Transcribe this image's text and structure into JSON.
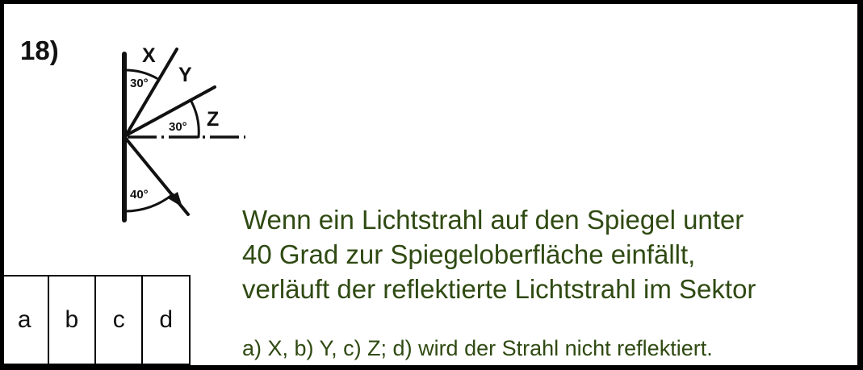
{
  "question_number": "18)",
  "diagram": {
    "label_x": "X",
    "label_y": "Y",
    "label_z": "Z",
    "angle_top": "30°",
    "angle_middle": "30°",
    "angle_bottom": "40°"
  },
  "question_lines": [
    "Wenn ein Lichtstrahl auf den Spiegel unter",
    "40 Grad zur Spiegeloberfläche einfällt,",
    "verläuft der reflektierte Lichtstrahl im Sektor"
  ],
  "options_text": "a) X, b) Y, c) Z; d) wird der Strahl nicht reflektiert.",
  "answer_boxes": [
    "a",
    "b",
    "c",
    "d"
  ],
  "colors": {
    "question_text": "#2f4a12",
    "border": "#000000"
  }
}
